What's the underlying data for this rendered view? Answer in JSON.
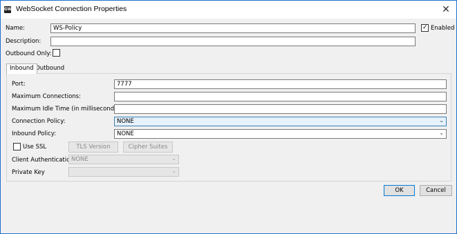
{
  "window": {
    "title": "WebSocket Connection Properties",
    "app_icon_text": "GW"
  },
  "general": {
    "name_label": "Name:",
    "name_value": "WS-Policy",
    "enabled_label": "Enabled",
    "enabled_checked": true,
    "description_label": "Description:",
    "description_value": "",
    "outbound_only_label": "Outbound Only:",
    "outbound_only_checked": false
  },
  "tabs": [
    {
      "label": "Inbound",
      "active": true
    },
    {
      "label": "Outbound",
      "active": false
    }
  ],
  "inbound": {
    "port_label": "Port:",
    "port_value": "7777",
    "max_connections_label": "Maximum Connections:",
    "max_connections_value": "",
    "max_idle_label": "Maximum Idle Time (in milliseconds):",
    "max_idle_value": "",
    "connection_policy_label": "Connection Policy:",
    "connection_policy_value": "NONE",
    "inbound_policy_label": "Inbound Policy:",
    "inbound_policy_value": "NONE",
    "use_ssl_label": "Use SSL",
    "use_ssl_checked": false,
    "tls_version_button": "TLS Version",
    "cipher_suites_button": "Cipher Suites",
    "client_auth_label": "Client Authentication",
    "client_auth_value": "NONE",
    "private_key_label": "Private Key",
    "private_key_value": ""
  },
  "footer": {
    "ok_label": "OK",
    "cancel_label": "Cancel"
  },
  "icons": {
    "close": "close-icon",
    "chevron": "chevron-down-icon",
    "check": "checkmark-icon"
  }
}
